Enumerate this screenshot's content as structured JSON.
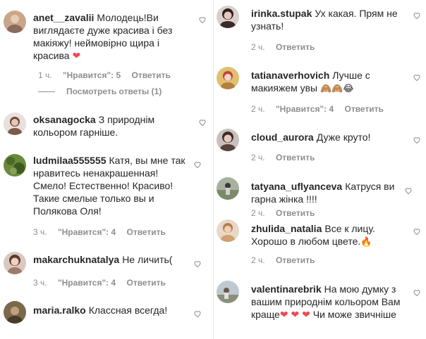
{
  "left": [
    {
      "user": "anet__zavalii",
      "text": "Молодець!Ви виглядаєте дуже красива і без макіяжу! неймовірно щира і красива",
      "emoji": "❤",
      "time": "1 ч.",
      "likes": "\"Нравится\": 5",
      "reply": "Ответить",
      "view_replies": "Посмотреть ответы (1)",
      "avatar_color": "#c9a68a"
    },
    {
      "user": "oksanagocka",
      "text": "З природнім кольором гарніше.",
      "avatar_color": "#7a5a4a"
    },
    {
      "user": "ludmilaa555555",
      "text": "Катя, вы мне так нравитесь ненакрашенная! Смело! Естественно! Красиво! Такие смелые только вы и Полякова Оля!",
      "time": "3 ч.",
      "likes": "\"Нравится\": 4",
      "reply": "Ответить",
      "avatar_color": "#5d7a3a"
    },
    {
      "user": "makarchuknatalya",
      "text": "Не личить(",
      "time": "3 ч.",
      "likes": "\"Нравится\": 4",
      "reply": "Ответить",
      "avatar_color": "#b08a7a"
    },
    {
      "user": "maria.ralko",
      "text": "Классная всегда!",
      "avatar_color": "#8a7a5a"
    }
  ],
  "right": [
    {
      "user": "irinka.stupak",
      "text": "Ух какая. Прям не узнать!",
      "time": "2 ч.",
      "reply": "Ответить",
      "avatar_color": "#4a3a3a"
    },
    {
      "user": "tatianaverhovich",
      "text": "Лучше с макияжем увы",
      "emoji": "🙈🙈😂",
      "time": "2 ч.",
      "likes": "\"Нравится\": 4",
      "reply": "Ответить",
      "avatar_color": "#d9b05a"
    },
    {
      "user": "cloud_aurora",
      "text": "Дуже круто!",
      "time": "2 ч.",
      "reply": "Ответить",
      "avatar_color": "#5a4a4a"
    },
    {
      "user": "tatyana_uflyanceva",
      "text": "Катруся ви гарна жінка !!!!",
      "time": "2 ч.",
      "reply": "Ответить",
      "avatar_color": "#8a9a8a"
    },
    {
      "user": "zhulida_natalia",
      "text": "Все к лицу. Хорошо в любом цвете.",
      "emoji": "🔥",
      "time": "2 ч.",
      "reply": "Ответить",
      "avatar_color": "#c9a080"
    },
    {
      "user": "valentinarebrik",
      "text": "На мою думку з вашим природнім кольором Вам краще",
      "emoji": "❤ ❤ ❤",
      "text2": "Чи може звичніше",
      "avatar_color": "#9aa0a8"
    }
  ]
}
